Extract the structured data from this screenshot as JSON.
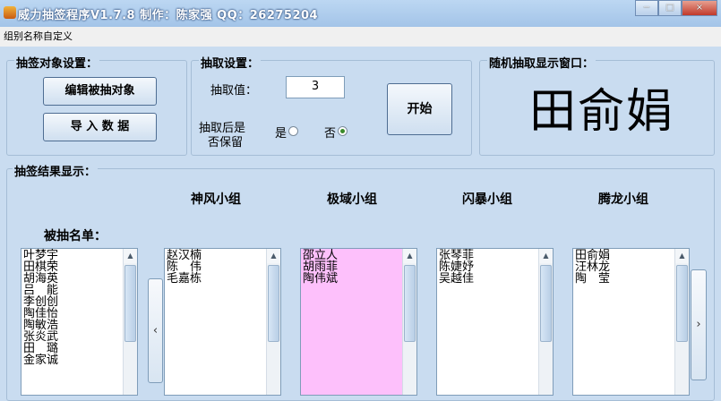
{
  "window": {
    "title": "威力抽签程序V1.7.8  制作：陈家强  QQ：26275204",
    "minimize": "−",
    "maximize": "□",
    "close": "×"
  },
  "menu": {
    "custom_group_names": "组别名称自定义"
  },
  "draw_object_settings": {
    "legend": "抽签对象设置：",
    "edit_button": "编辑被抽对象",
    "import_button": "导 入 数 据"
  },
  "draw_settings": {
    "legend": "抽取设置：",
    "count_label": "抽取值：",
    "count_value": "3",
    "keep_label_line1": "抽取后是",
    "keep_label_line2": "否保留",
    "yes_label": "是",
    "no_label": "否",
    "selected": "no",
    "start_button": "开始"
  },
  "display": {
    "legend": "随机抽取显示窗口：",
    "current_name": "田俞娟"
  },
  "results": {
    "legend": "抽签结果显示：",
    "pool_label": "被抽名单：",
    "pool": [
      "叶梦宇",
      "田棋荣",
      "胡海英",
      "吕　能",
      "李创创",
      "陶佳怡",
      "陶敏浩",
      "张炎武",
      "田　璐",
      "金家诚"
    ],
    "groups": [
      {
        "name": "神风小组",
        "members": [
          "赵汉楠",
          "陈　伟",
          "毛嘉栋"
        ]
      },
      {
        "name": "极域小组",
        "members": [
          "邵立人",
          "胡雨菲",
          "陶伟斌"
        ]
      },
      {
        "name": "闪暴小组",
        "members": [
          "张琴菲",
          "陈婕妤",
          "吴越佳"
        ]
      },
      {
        "name": "腾龙小组",
        "members": [
          "田俞娟",
          "汪林龙",
          "陶　莹"
        ]
      }
    ],
    "prev_button": "‹",
    "next_button": "›"
  },
  "icons": {
    "scroll_up": "▲",
    "scroll_down": "▼"
  }
}
